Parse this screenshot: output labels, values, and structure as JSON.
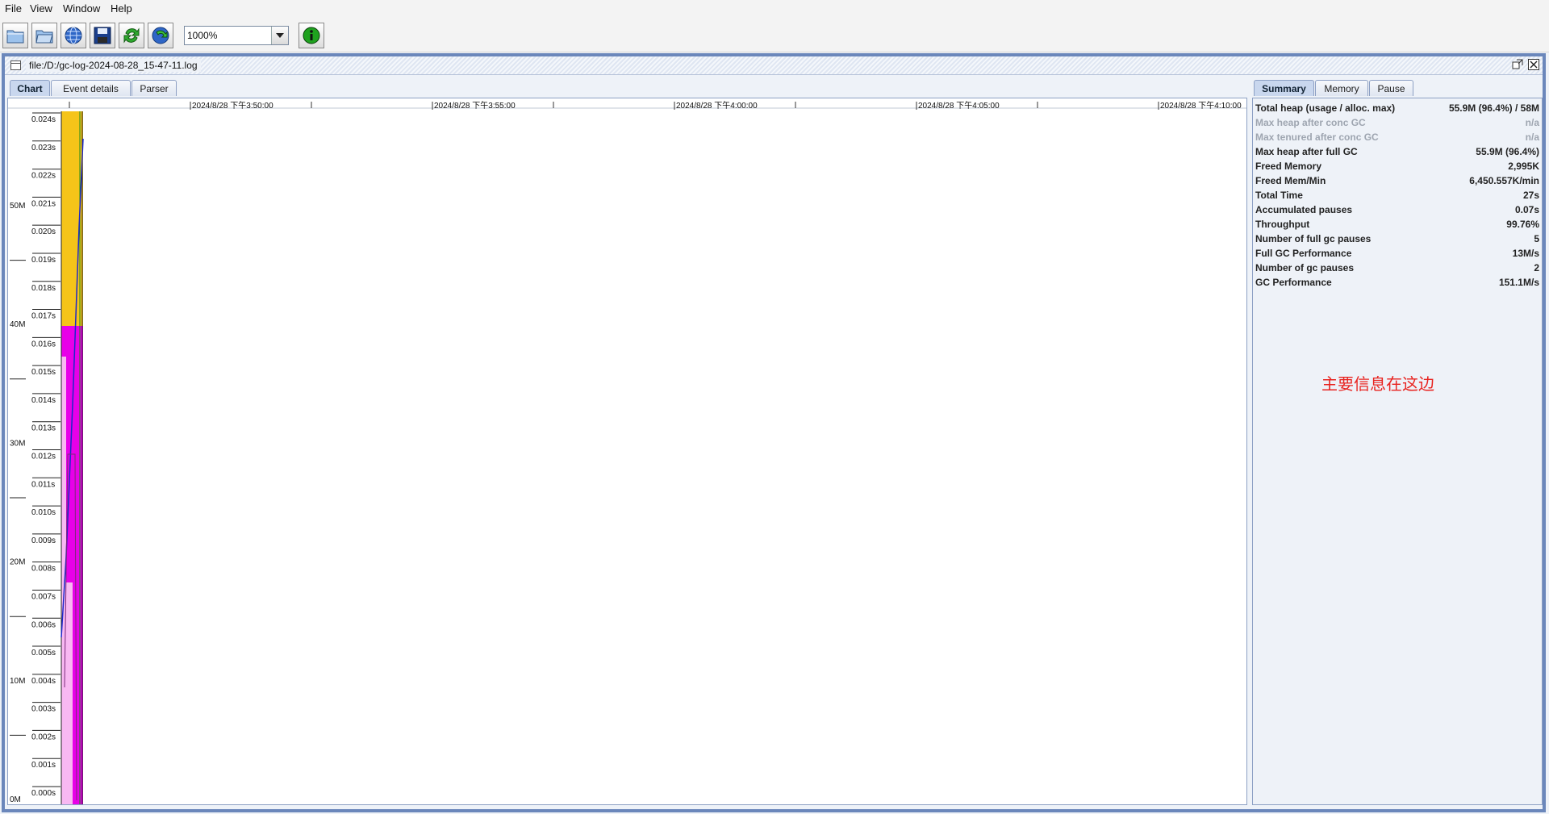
{
  "menu": [
    "File",
    "View",
    "Window",
    "Help"
  ],
  "toolbar": {
    "buttons": [
      "open-file-icon",
      "open-folder-icon",
      "open-url-icon",
      "save-icon",
      "refresh-icon",
      "watch-icon"
    ],
    "zoom_value": "1000%",
    "info_button": "info-icon"
  },
  "frame": {
    "title": "file:/D:/gc-log-2024-08-28_15-47-11.log"
  },
  "left_tabs": [
    "Chart",
    "Event details",
    "Parser"
  ],
  "right_tabs": [
    "Summary",
    "Memory",
    "Pause"
  ],
  "chart_data": {
    "type": "area",
    "x_ticks": [
      "2024/8/28 下午3:50:00",
      "2024/8/28 下午3:55:00",
      "2024/8/28 下午4:00:00",
      "2024/8/28 下午4:05:00",
      "2024/8/28 下午4:10:00"
    ],
    "memory_axis": [
      "50M",
      "40M",
      "30M",
      "20M",
      "10M",
      "0M"
    ],
    "pause_axis": [
      "0.024s",
      "0.023s",
      "0.022s",
      "0.021s",
      "0.020s",
      "0.019s",
      "0.018s",
      "0.017s",
      "0.016s",
      "0.015s",
      "0.014s",
      "0.013s",
      "0.012s",
      "0.011s",
      "0.010s",
      "0.009s",
      "0.008s",
      "0.007s",
      "0.006s",
      "0.005s",
      "0.004s",
      "0.003s",
      "0.002s",
      "0.001s",
      "0.000s"
    ],
    "series_colors": {
      "total_heap": "#f5c419",
      "tenured": "#e800e8",
      "young": "#f8b8f2",
      "used_heap": "#1c28c8",
      "gc_line": "#1a8a1a"
    }
  },
  "summary": {
    "rows": [
      {
        "label": "Total heap (usage / alloc. max)",
        "value": "55.9M (96.4%) / 58M",
        "dim": false
      },
      {
        "label": "Max heap after conc GC",
        "value": "n/a",
        "dim": true
      },
      {
        "label": "Max tenured after conc GC",
        "value": "n/a",
        "dim": true
      },
      {
        "label": "Max heap after full GC",
        "value": "55.9M (96.4%)",
        "dim": false
      },
      {
        "label": "Freed Memory",
        "value": "2,995K",
        "dim": false
      },
      {
        "label": "Freed Mem/Min",
        "value": "6,450.557K/min",
        "dim": false
      },
      {
        "label": "Total Time",
        "value": "27s",
        "dim": false
      },
      {
        "label": "Accumulated pauses",
        "value": "0.07s",
        "dim": false
      },
      {
        "label": "Throughput",
        "value": "99.76%",
        "dim": false
      },
      {
        "label": "Number of full gc pauses",
        "value": "5",
        "dim": false
      },
      {
        "label": "Full GC Performance",
        "value": "13M/s",
        "dim": false
      },
      {
        "label": "Number of gc pauses",
        "value": "2",
        "dim": false
      },
      {
        "label": "GC Performance",
        "value": "151.1M/s",
        "dim": false
      }
    ],
    "annotation": "主要信息在这边"
  }
}
